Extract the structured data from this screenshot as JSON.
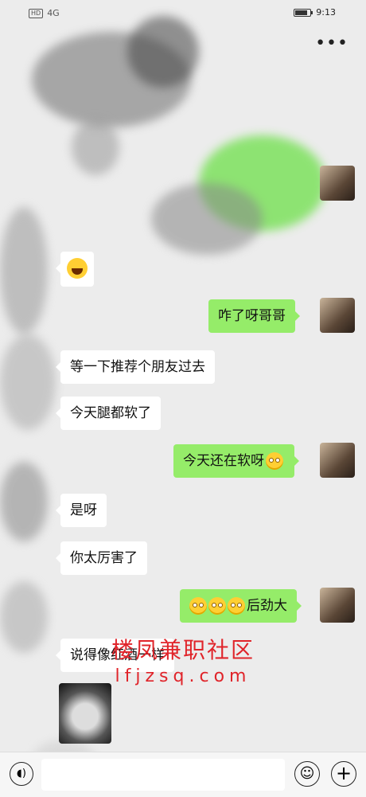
{
  "status_bar": {
    "network": "HD",
    "signal": "4G",
    "time": "9:13"
  },
  "header": {
    "more_label": "•••"
  },
  "messages": [
    {
      "id": "m1",
      "from": "other",
      "type": "emoji"
    },
    {
      "id": "m2",
      "from": "me",
      "text": "咋了呀哥哥"
    },
    {
      "id": "m3",
      "from": "other",
      "text": "等一下推荐个朋友过去"
    },
    {
      "id": "m4",
      "from": "other",
      "text": "今天腿都软了"
    },
    {
      "id": "m5",
      "from": "me",
      "text": "今天还在软呀"
    },
    {
      "id": "m6",
      "from": "other",
      "text": "是呀"
    },
    {
      "id": "m7",
      "from": "other",
      "text": "你太厉害了"
    },
    {
      "id": "m8",
      "from": "me",
      "text": "后劲大"
    },
    {
      "id": "m9",
      "from": "other",
      "text": "说得像红酒一样"
    },
    {
      "id": "m10",
      "from": "other",
      "type": "sticker"
    }
  ],
  "watermark": {
    "line1": "楼凤兼职社区",
    "line2": "lfjzsq.com"
  },
  "input_bar": {
    "text_value": ""
  },
  "colors": {
    "outgoing_bubble": "#95ec69",
    "incoming_bubble": "#ffffff",
    "watermark": "#e0242a",
    "background": "#ececec"
  }
}
